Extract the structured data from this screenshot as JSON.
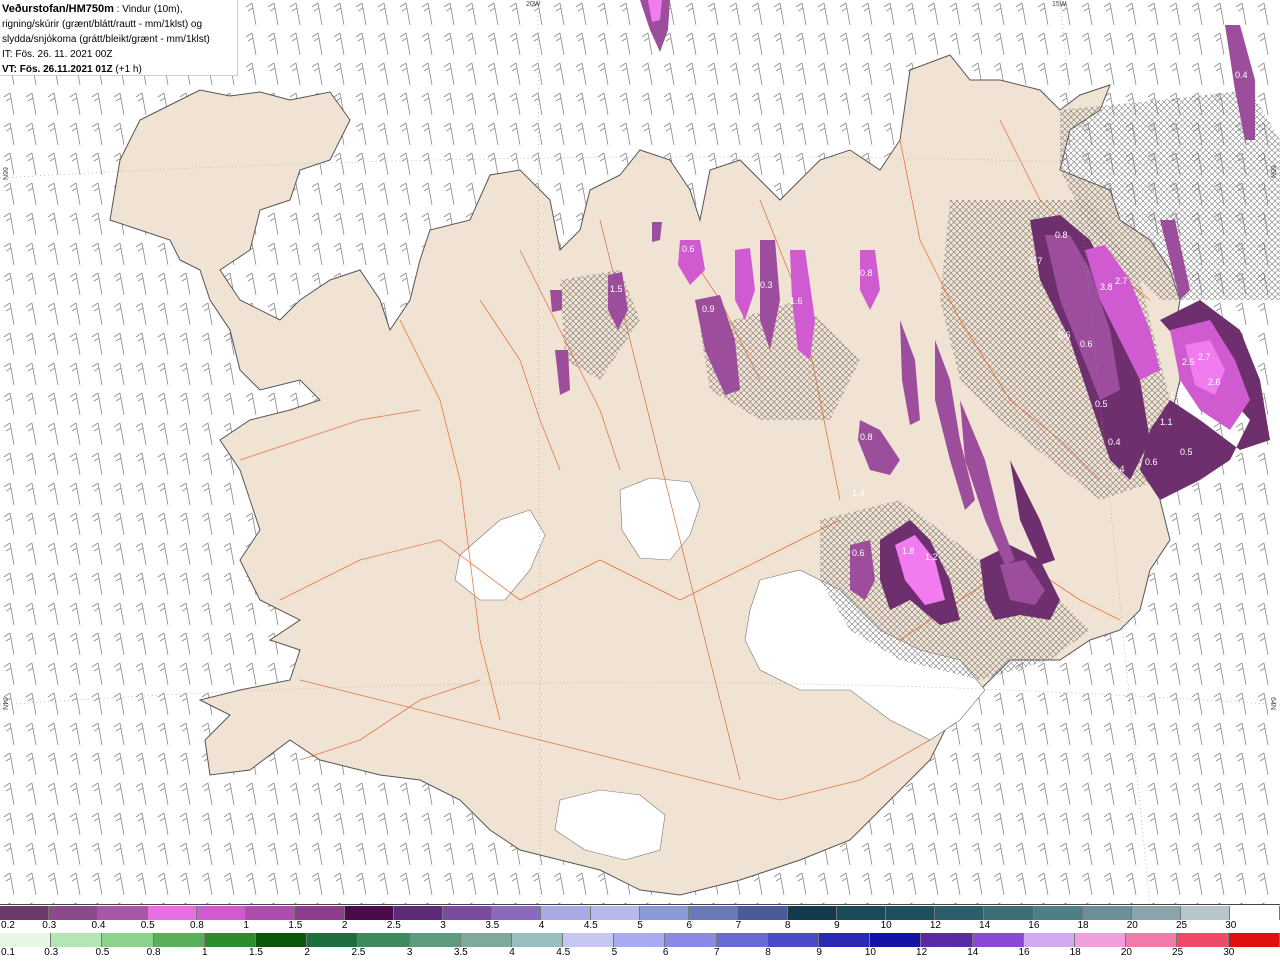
{
  "info": {
    "title": "Veðurstofan/HM750m",
    "title_rest": " : Vindur (10m),",
    "line2": "rigning/skúrir (grænt/blátt/rautt - mm/1klst) og",
    "line3": "slydda/snjókoma (grátt/bleikt/grænt - mm/1klst)",
    "it": "IT: Fös. 26. 11. 2021 00Z",
    "vt": "VT: Fös. 26.11.2021 01Z",
    "vt_lead": " (+1 h)"
  },
  "grid_labels": {
    "lon_20w": "20W",
    "lon_15w": "15W",
    "lat_66n_left": "66N",
    "lat_66n_right": "66N",
    "lat_64n_left": "64N",
    "lat_64n_right": "64N"
  },
  "values": [
    "0.4",
    "0.8",
    "0.6",
    "0.9",
    "0.3",
    "1.5",
    "1.6",
    "0.8",
    "0.7",
    "3.8",
    "2.7",
    "0.6",
    "0.6",
    "2.5",
    "2.7",
    "2.6",
    "1.5",
    "1.1",
    "0.4",
    "0.6",
    "0.5",
    "0.4",
    "0.5",
    "1.8",
    "1.2",
    "1.4",
    "0.6",
    "0.8"
  ],
  "colors": {
    "land": "#f1e3d3",
    "roads": "#e0652f",
    "glacier": "#ffffff",
    "coast": "#555555",
    "barb": "#8a8a8a",
    "sleet_light": "#9c4e9c",
    "sleet_mid": "#d05ad0",
    "sleet_strong": "#f07cf0",
    "sleet_dark": "#6e2f6e"
  },
  "legend_snow": {
    "labels": [
      "0.2",
      "0.3",
      "0.4",
      "0.5",
      "0.8",
      "1",
      "1.5",
      "2",
      "2.5",
      "3",
      "3.5",
      "4",
      "4.5",
      "5",
      "6",
      "7",
      "8",
      "9",
      "10",
      "12",
      "14",
      "16",
      "18",
      "20",
      "25",
      "30"
    ],
    "colors": [
      "#6b3a6b",
      "#8b4a8b",
      "#a857a8",
      "#e66fe6",
      "#d05ad0",
      "#b04cb0",
      "#8e3c8e",
      "#4b0a4b",
      "#5e2a7a",
      "#7a4a9e",
      "#8a6abf",
      "#a9a9e6",
      "#b8b8ea",
      "#8a9ad6",
      "#6a7ab8",
      "#4a5a9a",
      "#123a4a",
      "#1b4a5a",
      "#1d4f5f",
      "#2a5e6a",
      "#3e6e76",
      "#4e7e86",
      "#6a8f96",
      "#8aa4ab",
      "#b7c6ca",
      "#ffffff"
    ]
  },
  "legend_rain": {
    "labels": [
      "0.1",
      "0.3",
      "0.5",
      "0.8",
      "1",
      "1.5",
      "2",
      "2.5",
      "3",
      "3.5",
      "4",
      "4.5",
      "5",
      "6",
      "7",
      "8",
      "9",
      "10",
      "12",
      "14",
      "16",
      "18",
      "20",
      "25",
      "30"
    ],
    "colors": [
      "#e6f7e6",
      "#b4e6b4",
      "#8cd28c",
      "#5aaf5a",
      "#2e8b2e",
      "#0a5a0a",
      "#1e6e3e",
      "#3e8a5e",
      "#5e9a7e",
      "#7eaa9e",
      "#9abebe",
      "#c6c6f0",
      "#aaaaf0",
      "#8a8ae6",
      "#6a6ad6",
      "#4a4ac6",
      "#2a2ab6",
      "#1212a6",
      "#5a2aa6",
      "#8a4ad6",
      "#d2aaf0",
      "#f0a0d8",
      "#f07aa8",
      "#f04a6a",
      "#e01010"
    ]
  }
}
